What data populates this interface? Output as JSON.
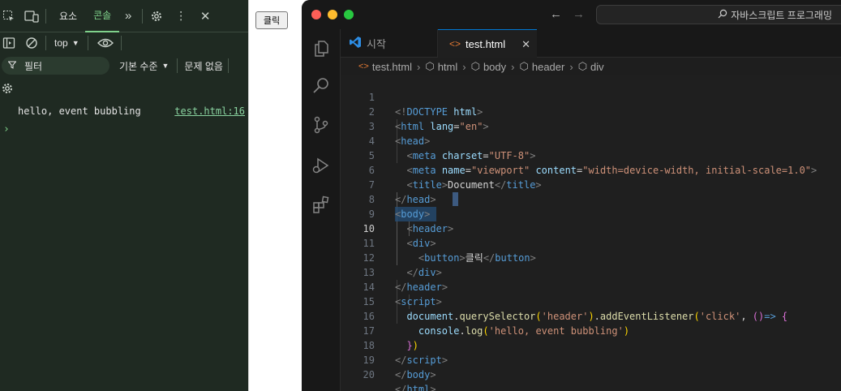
{
  "devtools": {
    "tabs": [
      "요소",
      "콘솔"
    ],
    "active_tab": "콘솔",
    "context": "top",
    "filter": "필터",
    "level": "기본 수준",
    "issues": "문제 없음",
    "log": {
      "message": "hello, event bubbling",
      "source": "test.html:16"
    },
    "prompt": "›"
  },
  "preview": {
    "button_label": "클릭"
  },
  "vscode": {
    "command_center": "자바스크립트 프로그래밍",
    "tabs": [
      {
        "label": "시작"
      },
      {
        "label": "test.html"
      }
    ],
    "breadcrumb": [
      "test.html",
      "html",
      "body",
      "header",
      "div"
    ],
    "active_line": 10,
    "lines": [
      {
        "n": "1"
      },
      {
        "n": "2"
      },
      {
        "n": "3"
      },
      {
        "n": "4"
      },
      {
        "n": "5"
      },
      {
        "n": "6"
      },
      {
        "n": "7"
      },
      {
        "n": "8"
      },
      {
        "n": "9"
      },
      {
        "n": "10"
      },
      {
        "n": "11"
      },
      {
        "n": "12"
      },
      {
        "n": "13"
      },
      {
        "n": "14"
      },
      {
        "n": "15"
      },
      {
        "n": "16"
      },
      {
        "n": "17"
      },
      {
        "n": "18"
      },
      {
        "n": "19"
      },
      {
        "n": "20"
      }
    ],
    "code": {
      "doctype": "html",
      "lang_attr": "lang",
      "lang_val": "\"en\"",
      "charset_attr": "charset",
      "charset_val": "\"UTF-8\"",
      "name_attr": "name",
      "name_val": "\"viewport\"",
      "content_attr": "content",
      "content_val": "\"width=device-width, initial-scale=1.0\"",
      "title_text": "Document",
      "button_text": "클릭",
      "js_document": "document",
      "js_qs": "querySelector",
      "js_header": "'header'",
      "js_add": "addEventListener",
      "js_click": "'click'",
      "js_console": "console",
      "js_log": "log",
      "js_msg": "'hello, event bubbling'"
    }
  },
  "colors": {
    "accent": "#0078d4",
    "devtools_bg": "#1f2a22",
    "devtools_accent": "#7fd18b",
    "editor_bg": "#1f1f1f"
  }
}
